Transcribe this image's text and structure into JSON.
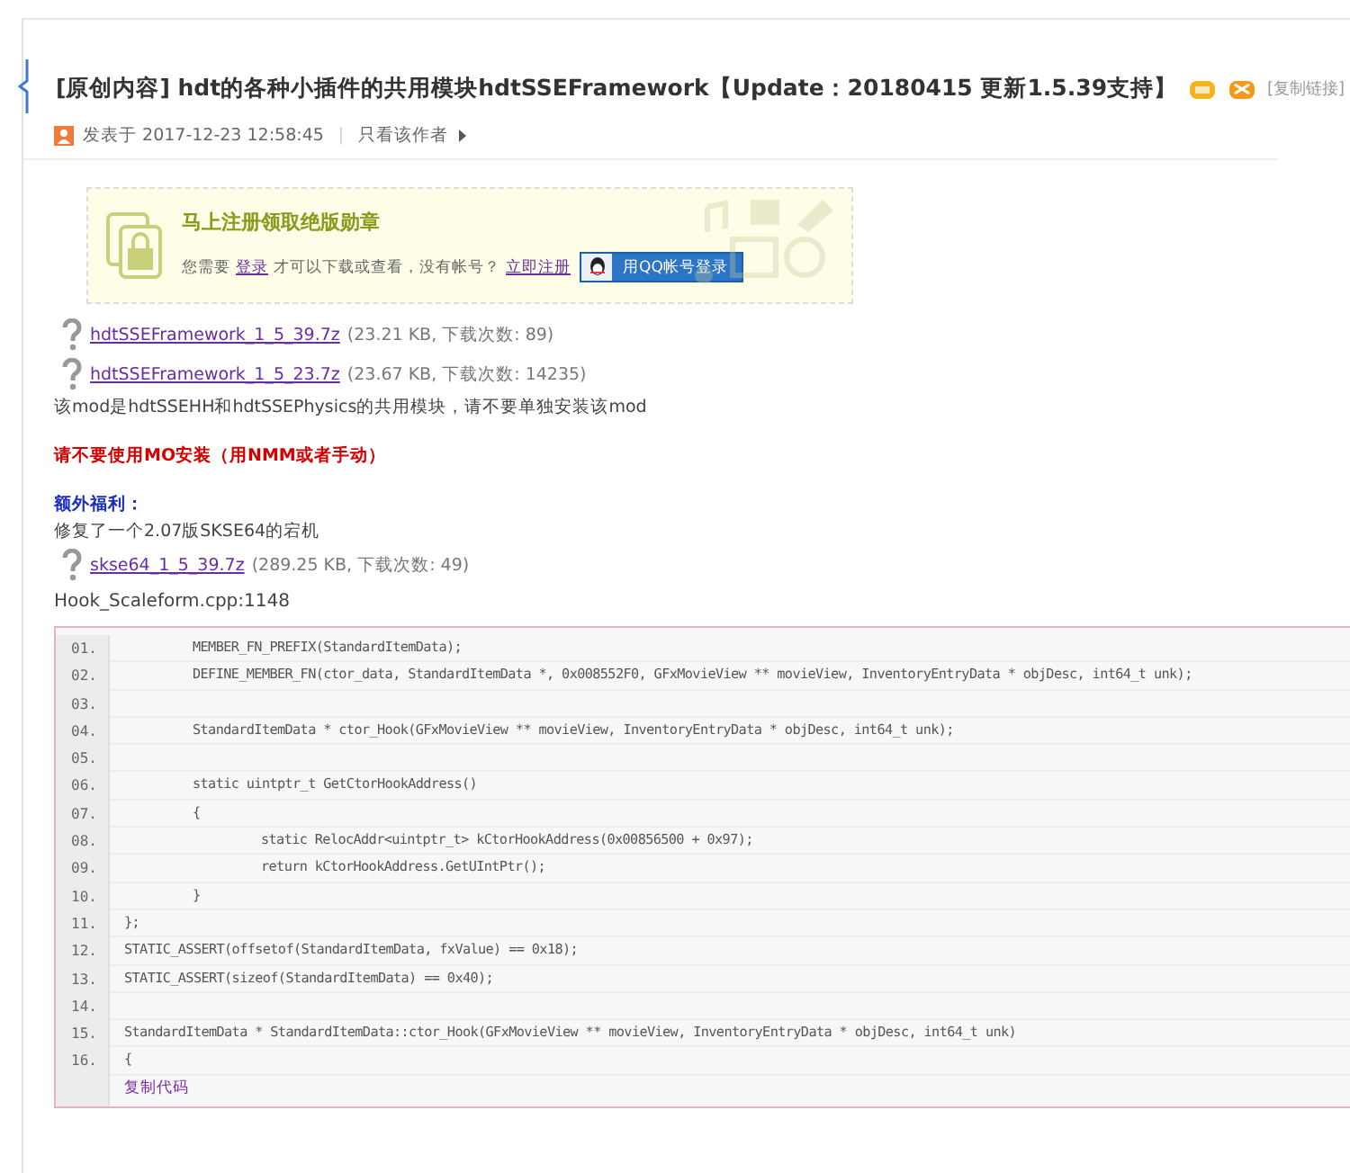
{
  "post": {
    "tag": "[原创内容]",
    "title": "hdt的各种小插件的共用模块hdtSSEFramework【Update：20180415 更新1.5.39支持】",
    "copy_link": "[复制链接]",
    "posted": "发表于 2017-12-23 12:58:45",
    "separator": "|",
    "author_only": "只看该作者"
  },
  "login_notice": {
    "heading": "马上注册领取绝版勋章",
    "before": "您需要",
    "login": "登录",
    "middle": "才可以下载或查看，没有帐号？",
    "register": "立即注册",
    "qq_button": "用QQ帐号登录"
  },
  "body": [
    {
      "kind": "file",
      "name": "hdtSSEFramework_1_5_39.7z",
      "info": "(23.21 KB, 下载次数: 89)"
    },
    {
      "kind": "file",
      "name": "hdtSSEFramework_1_5_23.7z",
      "info": "(23.67 KB, 下载次数: 14235)"
    },
    {
      "kind": "text",
      "text": "该mod是hdtSSEHH和hdtSSEPhysics的共用模块，请不要单独安装该mod"
    },
    {
      "kind": "gap"
    },
    {
      "kind": "warning",
      "text": "请不要使用MO安装（用NMM或者手动）"
    },
    {
      "kind": "gap"
    },
    {
      "kind": "subheading",
      "text": "额外福利："
    },
    {
      "kind": "text",
      "text": "修复了一个2.07版SKSE64的宕机"
    },
    {
      "kind": "file",
      "name": "skse64_1_5_39.7z",
      "info": "(289.25 KB, 下载次数: 49)"
    },
    {
      "kind": "caption",
      "text": "Hook_Scaleform.cpp:1148"
    }
  ],
  "code": {
    "lines": [
      {
        "no": "01.",
        "text": "\tMEMBER_FN_PREFIX(StandardItemData);"
      },
      {
        "no": "02.",
        "text": "\tDEFINE_MEMBER_FN(ctor_data, StandardItemData *, 0x008552F0, GFxMovieView ** movieView, InventoryEntryData * objDesc, int64_t unk);"
      },
      {
        "no": "03."
      },
      {
        "no": "04.",
        "text": "\tStandardItemData * ctor_Hook(GFxMovieView ** movieView, InventoryEntryData * objDesc, int64_t unk);"
      },
      {
        "no": "05."
      },
      {
        "no": "06.",
        "text": "\tstatic uintptr_t GetCtorHookAddress()"
      },
      {
        "no": "07.",
        "text": "\t{"
      },
      {
        "no": "08.",
        "text": "\t\tstatic RelocAddr<uintptr_t> kCtorHookAddress(0x00856500 + 0x97);"
      },
      {
        "no": "09.",
        "text": "\t\treturn kCtorHookAddress.GetUIntPtr();"
      },
      {
        "no": "10.",
        "text": "\t}"
      },
      {
        "no": "11.",
        "text": "};"
      },
      {
        "no": "12.",
        "text": "STATIC_ASSERT(offsetof(StandardItemData, fxValue) == 0x18);"
      },
      {
        "no": "13.",
        "text": "STATIC_ASSERT(sizeof(StandardItemData) == 0x40);"
      },
      {
        "no": "14."
      },
      {
        "no": "15.",
        "text": "StandardItemData * StandardItemData::ctor_Hook(GFxMovieView ** movieView, InventoryEntryData * objDesc, int64_t unk)"
      },
      {
        "no": "16.",
        "text": "{"
      }
    ],
    "copy": "复制代码"
  }
}
